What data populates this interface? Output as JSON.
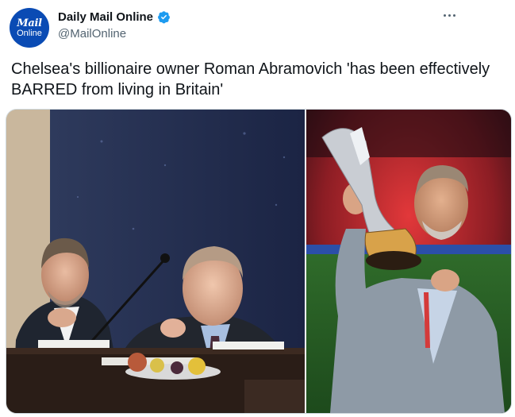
{
  "account": {
    "avatar_line1": "Mail",
    "avatar_line2": "Online",
    "display_name": "Daily Mail Online",
    "handle": "@MailOnline"
  },
  "tweet": {
    "text": "Chelsea's billionaire owner Roman Abramovich 'has been effectively BARRED from living in Britain'"
  },
  "colors": {
    "avatar_bg": "#0a4bb4",
    "verified": "#1d9bf0",
    "handle_grey": "#536471"
  },
  "icons": {
    "verified": "verified-badge-icon",
    "more": "more-options-icon"
  },
  "media": {
    "count": 2
  }
}
